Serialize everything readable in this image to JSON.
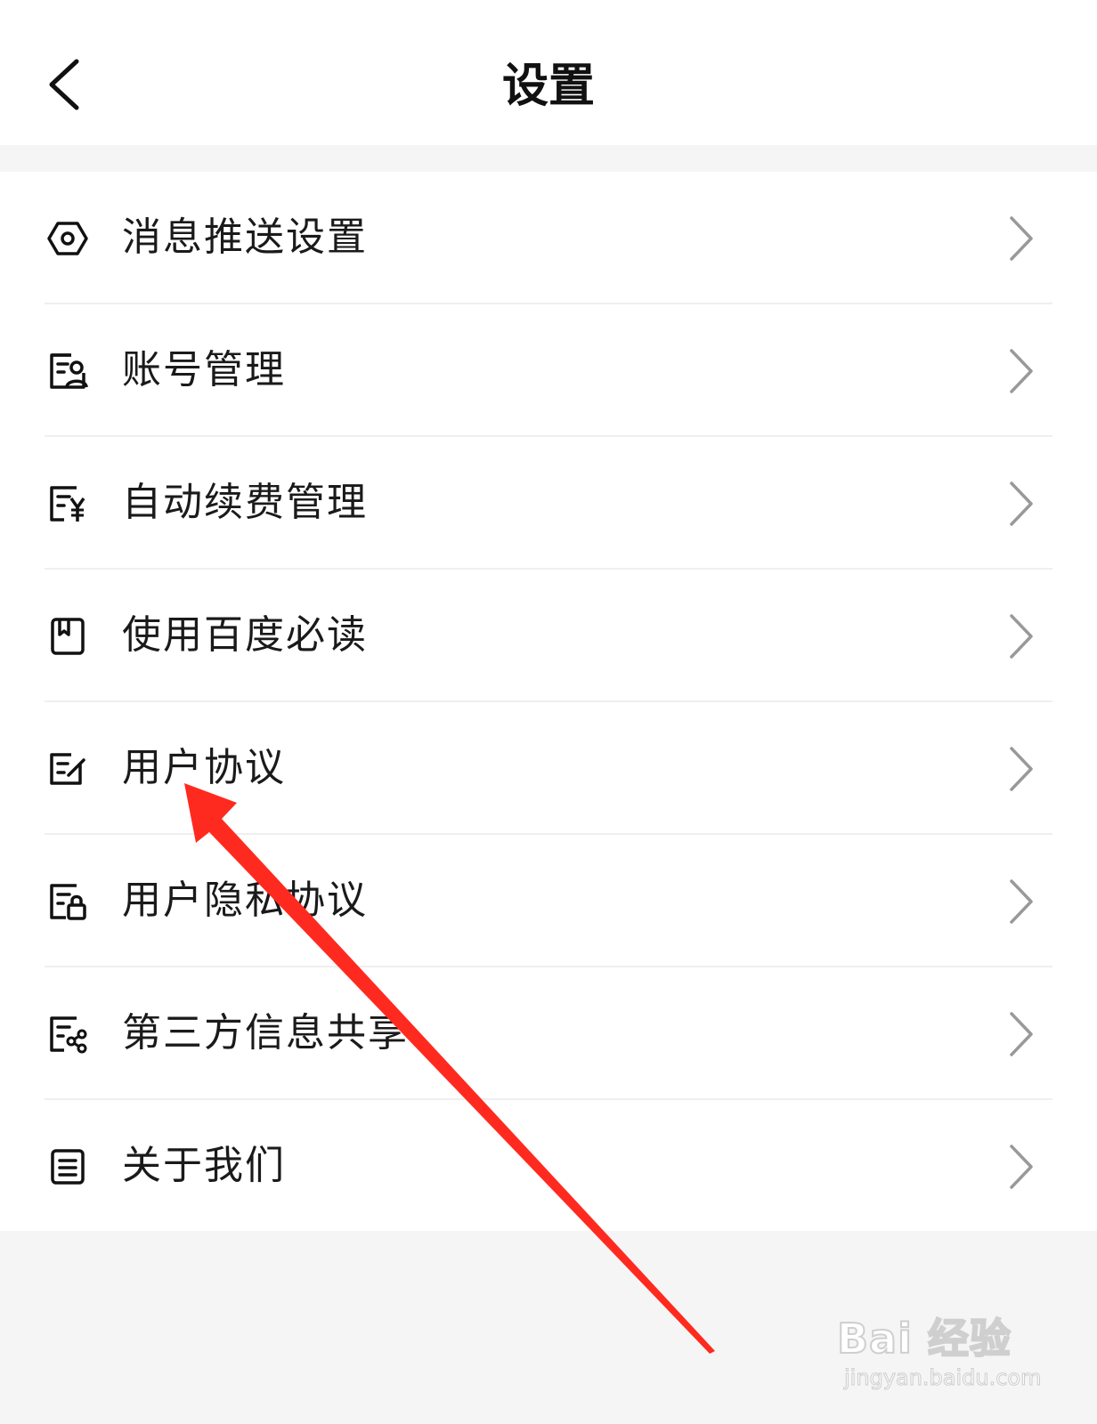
{
  "header": {
    "title": "设置"
  },
  "settings": {
    "items": [
      {
        "label": "消息推送设置",
        "icon": "gear-hex-icon"
      },
      {
        "label": "账号管理",
        "icon": "account-card-icon"
      },
      {
        "label": "自动续费管理",
        "icon": "auto-renew-yen-icon"
      },
      {
        "label": "使用百度必读",
        "icon": "book-icon"
      },
      {
        "label": "用户协议",
        "icon": "edit-document-icon"
      },
      {
        "label": "用户隐私协议",
        "icon": "privacy-lock-icon"
      },
      {
        "label": "第三方信息共享",
        "icon": "share-nodes-icon"
      },
      {
        "label": "关于我们",
        "icon": "list-document-icon"
      }
    ]
  },
  "annotation": {
    "color": "#ff2a1f",
    "points_to": "用户协议"
  },
  "watermark": {
    "logo": "Bai 经验",
    "url": "jingyan.baidu.com"
  }
}
